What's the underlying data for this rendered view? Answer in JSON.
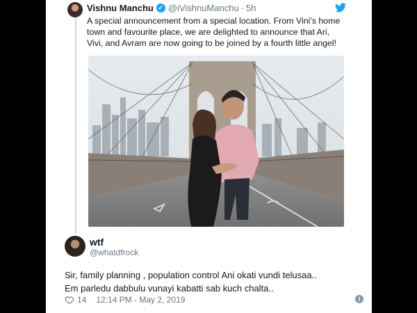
{
  "quoted_tweet": {
    "author_name": "Vishnu Manchu",
    "author_handle": "@iVishnuManchu",
    "time": "5h",
    "text": "A special announcement from a special location. From Vini's home town and favourite place, we are delighted to announce that Ari, Vivi, and Avram are now going to be joined by a fourth little angel!"
  },
  "reply_tweet": {
    "author_name": "wtf",
    "author_handle": "@whatdfrock",
    "text_line1": "Sir, family planning , population control Ani okati vundi telusaa..",
    "text_line2": "Em parledu dabbulu vunayi kabatti sab kuch chalta..",
    "likes": "14",
    "timestamp": "12:14 PM - May 2, 2019"
  },
  "colors": {
    "twitter_blue": "#1da1f2",
    "secondary_text": "#657786",
    "background": "#000000"
  }
}
